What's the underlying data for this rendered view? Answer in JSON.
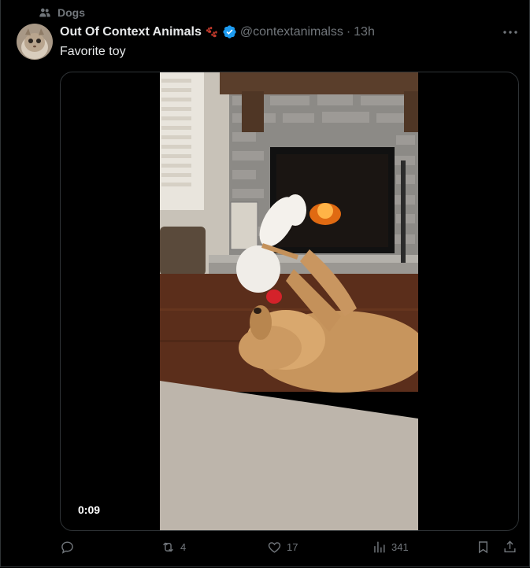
{
  "social_context": {
    "label": "Dogs",
    "icon": "people-icon"
  },
  "author": {
    "name": "Out Of Context Animals",
    "name_emoji": "paw-prints",
    "verified": true,
    "handle": "@contextanimalss",
    "separator": "·",
    "time": "13h"
  },
  "tweet": {
    "text": "Favorite toy"
  },
  "media": {
    "type": "video",
    "duration": "0:09"
  },
  "actions": {
    "reply": {
      "icon": "reply-icon",
      "count": ""
    },
    "retweet": {
      "icon": "retweet-icon",
      "count": "4"
    },
    "like": {
      "icon": "heart-icon",
      "count": "17"
    },
    "views": {
      "icon": "views-icon",
      "count": "341"
    },
    "bookmark": {
      "icon": "bookmark-icon"
    },
    "share": {
      "icon": "share-icon"
    }
  },
  "colors": {
    "background": "#000000",
    "text": "#e7e9ea",
    "muted": "#71767b",
    "verified": "#1d9bf0",
    "border": "#2f3336"
  }
}
